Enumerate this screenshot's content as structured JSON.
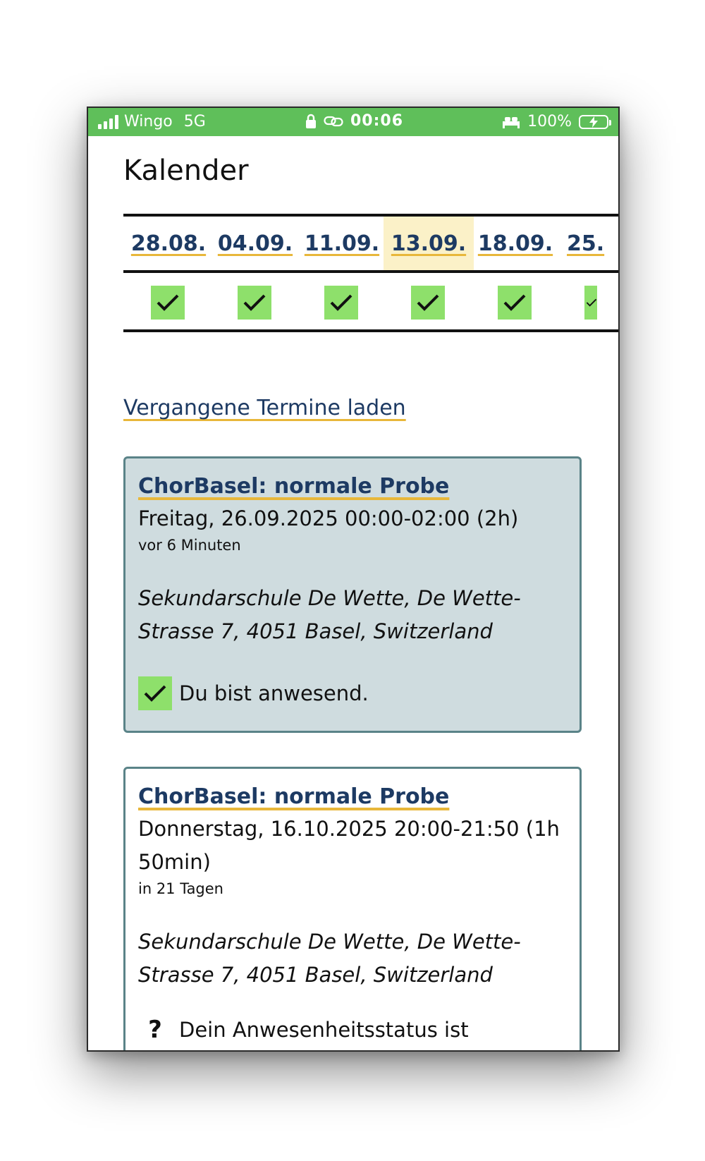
{
  "statusbar": {
    "carrier": "Wingo",
    "network": "5G",
    "time": "00:06",
    "battery": "100%",
    "color": "#5fbf5a"
  },
  "page": {
    "title": "Kalender"
  },
  "calendar": {
    "dates": [
      "28.08.",
      "04.09.",
      "11.09.",
      "13.09.",
      "18.09.",
      "25."
    ],
    "highlighted_index": 3,
    "attendance": [
      "check",
      "check",
      "check",
      "check",
      "check",
      "check"
    ],
    "check_color": "#8ee06b",
    "highlight_color": "#fbf1c8"
  },
  "links": {
    "past": "Vergangene Termine laden"
  },
  "events": [
    {
      "title": "ChorBasel: normale Probe",
      "when": "Freitag, 26.09.2025 00:00-02:00 (2h)",
      "relative": "vor 6 Minuten",
      "location": "Sekundarschule De Wette, De Wette-Strasse 7, 4051 Basel, Switzerland",
      "status": "Du bist anwesend.",
      "status_icon": "check-icon"
    },
    {
      "title": "ChorBasel: normale Probe",
      "when": "Donnerstag, 16.10.2025 20:00-21:50 (1h 50min)",
      "relative": "in 21 Tagen",
      "location": "Sekundarschule De Wette, De Wette-Strasse 7, 4051 Basel, Switzerland",
      "status": "Dein Anwesenheitsstatus ist",
      "status_icon": "question-icon"
    }
  ],
  "colors": {
    "link": "#1d3a63",
    "underline": "#e8b73a",
    "card_border": "#5a8388",
    "past_card_bg": "#cfdcdf"
  }
}
